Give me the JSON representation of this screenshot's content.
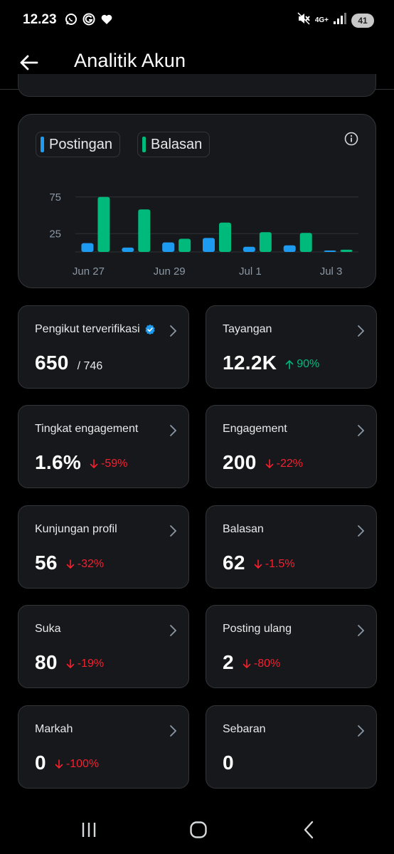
{
  "status_bar": {
    "time": "12.23",
    "network": "4G+",
    "battery": "41",
    "icons": [
      "whatsapp-icon",
      "g-icon",
      "heart-icon",
      "mute-icon",
      "signal-icon"
    ]
  },
  "header": {
    "title": "Analitik Akun",
    "back_icon": "arrow-left-icon"
  },
  "chart": {
    "legend": [
      {
        "label": "Postingan",
        "color": "#1d9bf0"
      },
      {
        "label": "Balasan",
        "color": "#00ba7c"
      }
    ],
    "info_icon": "info-icon"
  },
  "chart_data": {
    "type": "bar",
    "categories": [
      "Jun 27",
      "Jun 28",
      "Jun 29",
      "Jun 30",
      "Jul 1",
      "Jul 2",
      "Jul 3"
    ],
    "x_tick_labels": [
      "Jun 27",
      "Jun 29",
      "Jul 1",
      "Jul 3"
    ],
    "y_tick_labels": [
      "75",
      "25"
    ],
    "ylim": [
      0,
      100
    ],
    "grid": true,
    "legend_position": "top-left",
    "series": [
      {
        "name": "Postingan",
        "color": "#1d9bf0",
        "values": [
          12,
          6,
          13,
          19,
          7,
          9,
          2
        ]
      },
      {
        "name": "Balasan",
        "color": "#00ba7c",
        "values": [
          75,
          58,
          18,
          40,
          27,
          26,
          3
        ]
      }
    ]
  },
  "stats": [
    {
      "label": "Pengikut terverifikasi",
      "verified": true,
      "value": "650",
      "sub": "/ 746",
      "change": "",
      "direction": ""
    },
    {
      "label": "Tayangan",
      "verified": false,
      "value": "12.2K",
      "sub": "",
      "change": "90%",
      "direction": "up"
    },
    {
      "label": "Tingkat engagement",
      "verified": false,
      "value": "1.6%",
      "sub": "",
      "change": "-59%",
      "direction": "down"
    },
    {
      "label": "Engagement",
      "verified": false,
      "value": "200",
      "sub": "",
      "change": "-22%",
      "direction": "down"
    },
    {
      "label": "Kunjungan profil",
      "verified": false,
      "value": "56",
      "sub": "",
      "change": "-32%",
      "direction": "down"
    },
    {
      "label": "Balasan",
      "verified": false,
      "value": "62",
      "sub": "",
      "change": "-1.5%",
      "direction": "down"
    },
    {
      "label": "Suka",
      "verified": false,
      "value": "80",
      "sub": "",
      "change": "-19%",
      "direction": "down"
    },
    {
      "label": "Posting ulang",
      "verified": false,
      "value": "2",
      "sub": "",
      "change": "-80%",
      "direction": "down"
    },
    {
      "label": "Markah",
      "verified": false,
      "value": "0",
      "sub": "",
      "change": "-100%",
      "direction": "down"
    },
    {
      "label": "Sebaran",
      "verified": false,
      "value": "0",
      "sub": "",
      "change": "",
      "direction": ""
    }
  ],
  "nav": {
    "recents_icon": "recents-icon",
    "home_icon": "home-icon",
    "back_icon": "nav-back-icon"
  },
  "colors": {
    "background": "#000000",
    "card": "#16181c",
    "border": "#333639",
    "up": "#00ba7c",
    "down": "#f4212e",
    "verified": "#1d9bf0"
  }
}
